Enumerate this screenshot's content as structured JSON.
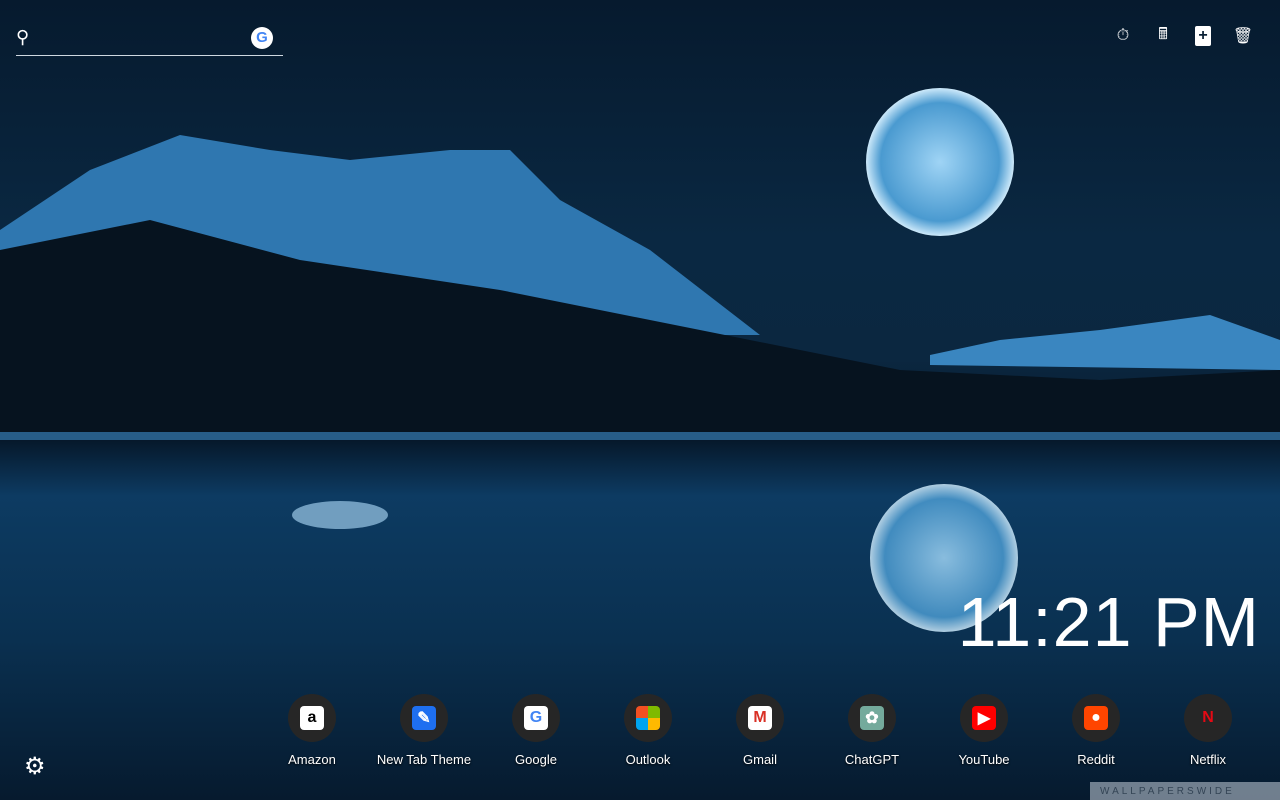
{
  "search": {
    "placeholder": "",
    "engine": "G"
  },
  "toolbar": [
    {
      "name": "timer-icon",
      "glyph": "⏱"
    },
    {
      "name": "calculator-icon",
      "glyph": "🖩"
    },
    {
      "name": "new-note-icon",
      "glyph": "+"
    },
    {
      "name": "trash-icon",
      "glyph": "🗑"
    }
  ],
  "clock": {
    "time": "11:21 PM"
  },
  "shortcuts": [
    {
      "label": "Amazon",
      "glyph": "a",
      "bg": "#ffffff",
      "fg": "#000000"
    },
    {
      "label": "New Tab Theme",
      "glyph": "✎",
      "bg": "#1e6ff0",
      "fg": "#ffffff"
    },
    {
      "label": "Google",
      "glyph": "G",
      "bg": "#ffffff",
      "fg": "#4285f4"
    },
    {
      "label": "Outlook",
      "glyph": "",
      "bg": "conic-gradient(#7fba00 0 25%,#ffb900 0 50%,#00a4ef 0 75%,#f25022 0)",
      "fg": "#fff"
    },
    {
      "label": "Gmail",
      "glyph": "M",
      "bg": "#ffffff",
      "fg": "#d93025"
    },
    {
      "label": "ChatGPT",
      "glyph": "✿",
      "bg": "#74aa9c",
      "fg": "#ffffff"
    },
    {
      "label": "YouTube",
      "glyph": "▶",
      "bg": "#ff0000",
      "fg": "#ffffff"
    },
    {
      "label": "Reddit",
      "glyph": "●",
      "bg": "#ff4500",
      "fg": "#ffffff"
    },
    {
      "label": "Netflix",
      "glyph": "N",
      "bg": "transparent",
      "fg": "#e50914"
    }
  ],
  "settings": {
    "glyph": "⚙"
  },
  "watermark": "WALLPAPERSWIDE"
}
